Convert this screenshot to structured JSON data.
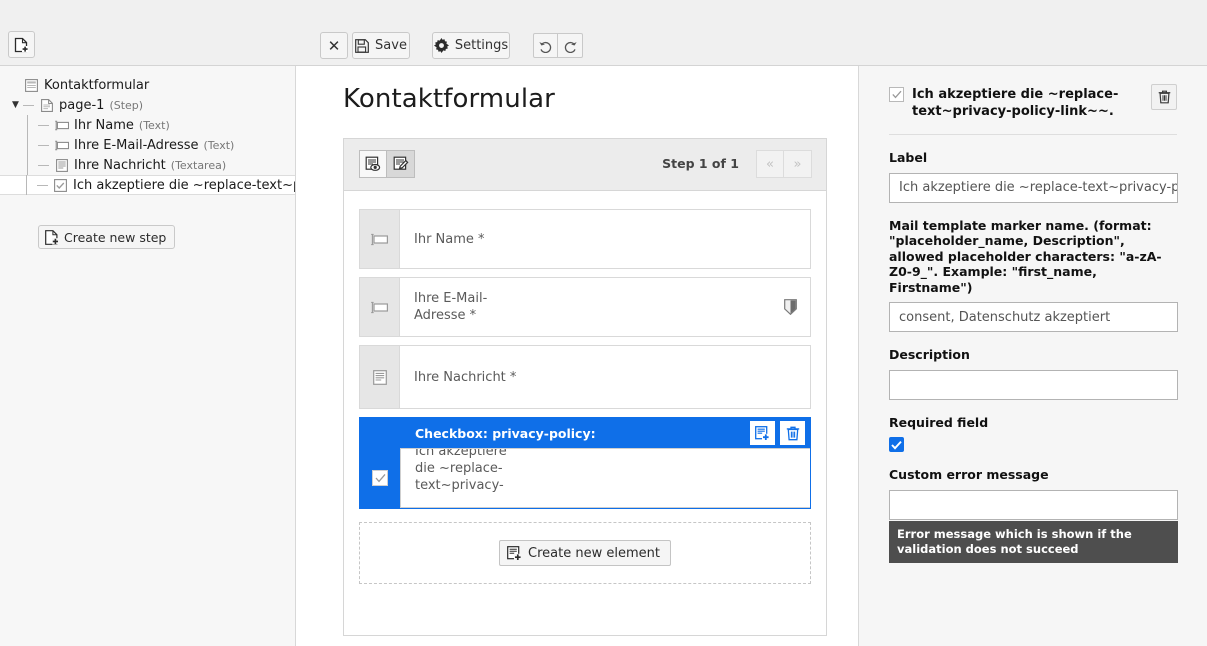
{
  "toolbar": {
    "new_document_icon": "new-document-icon",
    "close_label": "✕",
    "save_label": "Save",
    "save_icon": "floppy-disk-icon",
    "settings_label": "Settings",
    "settings_icon": "gear-icon",
    "undo_icon": "undo-icon",
    "redo_icon": "redo-icon"
  },
  "sidebar": {
    "tree": [
      {
        "label": "Kontaktformular",
        "type": "",
        "icon": "form-icon",
        "selected": false
      },
      {
        "label": "page-1",
        "type": "(Step)",
        "icon": "page-icon",
        "selected": false
      },
      {
        "label": "Ihr Name",
        "type": "(Text)",
        "icon": "text-input-icon",
        "selected": false
      },
      {
        "label": "Ihre E-Mail-Adresse",
        "type": "(Text)",
        "icon": "text-input-icon",
        "selected": false
      },
      {
        "label": "Ihre Nachricht",
        "type": "(Textarea)",
        "icon": "textarea-icon",
        "selected": false
      },
      {
        "label": "Ich akzeptiere die ~replace-text~pri",
        "type": "",
        "icon": "checkbox-icon",
        "selected": true
      }
    ],
    "create_step_label": "Create new step",
    "create_step_icon": "add-page-icon"
  },
  "canvas": {
    "page_title": "Kontaktformular",
    "view_preview_icon": "preview-eye-icon",
    "view_edit_icon": "edit-pencil-icon",
    "step_label": "Step 1 of 1",
    "prev_label": "«",
    "next_label": "»",
    "fields": [
      {
        "label": "Ihr Name *",
        "icon": "text-input-icon",
        "badge": ""
      },
      {
        "label": "Ihre E-Mail-Adresse *",
        "icon": "text-input-icon",
        "badge": "shield-icon"
      },
      {
        "label": "Ihre Nachricht *",
        "icon": "textarea-icon",
        "badge": ""
      }
    ],
    "selected_element": {
      "header": "Checkbox: privacy-policy:",
      "body_text": "Ich akzeptiere die ~replace-text~privacy-",
      "add_icon": "add-element-icon",
      "delete_icon": "trash-icon"
    },
    "create_element_label": "Create new element",
    "create_element_icon": "add-element-icon"
  },
  "inspector": {
    "title": "Ich akzeptiere die ~replace-text~privacy-policy-link~~.",
    "delete_icon": "trash-icon",
    "label_heading": "Label",
    "label_value": "Ich akzeptiere die ~replace-text~privacy-poli",
    "marker_heading": "Mail template marker name. (format: \"placeholder_name, Description\", allowed placeholder characters: \"a-zA-Z0-9_\". Example: \"first_name, Firstname\")",
    "marker_value": "consent, Datenschutz akzeptiert",
    "description_heading": "Description",
    "description_value": "",
    "required_heading": "Required field",
    "required_checked": true,
    "error_heading": "Custom error message",
    "error_value": "",
    "error_tooltip": "Error message which is shown if the validation does not succeed"
  },
  "colors": {
    "accent_blue": "#0f6fe8",
    "toolbar_bg": "#f0f0f0",
    "panel_bg": "#f6f6f6",
    "tooltip_bg": "#4e4e4e"
  }
}
